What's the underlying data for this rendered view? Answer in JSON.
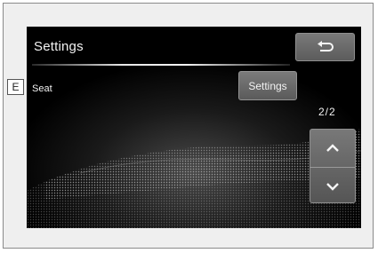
{
  "screen": {
    "title": "Settings",
    "back_icon": "return-arrow-icon",
    "seat_label": "Seat",
    "settings_button_label": "Settings",
    "page_indicator": "2/2",
    "scroll_up_icon": "chevron-up-icon",
    "scroll_down_icon": "chevron-down-icon"
  },
  "callout": {
    "label": "E"
  }
}
